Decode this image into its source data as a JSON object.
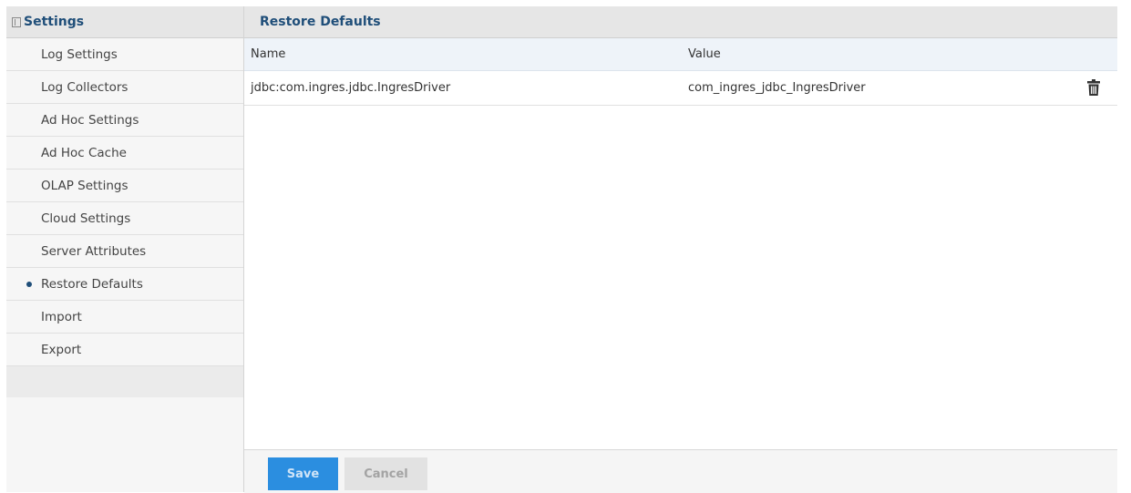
{
  "sidebar": {
    "title": "Settings",
    "items": [
      {
        "label": "Log Settings"
      },
      {
        "label": "Log Collectors"
      },
      {
        "label": "Ad Hoc Settings"
      },
      {
        "label": "Ad Hoc Cache"
      },
      {
        "label": "OLAP Settings"
      },
      {
        "label": "Cloud Settings"
      },
      {
        "label": "Server Attributes"
      },
      {
        "label": "Restore Defaults",
        "active": true
      },
      {
        "label": "Import"
      },
      {
        "label": "Export"
      }
    ]
  },
  "main": {
    "title": "Restore Defaults",
    "table": {
      "columns": [
        "Name",
        "Value"
      ],
      "rows": [
        {
          "name": "jdbc:com.ingres.jdbc.IngresDriver",
          "value": "com_ingres_jdbc_IngresDriver",
          "action_icon": "trash-icon"
        }
      ]
    },
    "footer": {
      "save_label": "Save",
      "cancel_label": "Cancel"
    }
  },
  "colors": {
    "accent": "#1f4e79",
    "primary_button": "#2b8ee0",
    "header_bg": "#e6e6e6",
    "table_header_bg": "#eef3f9"
  }
}
